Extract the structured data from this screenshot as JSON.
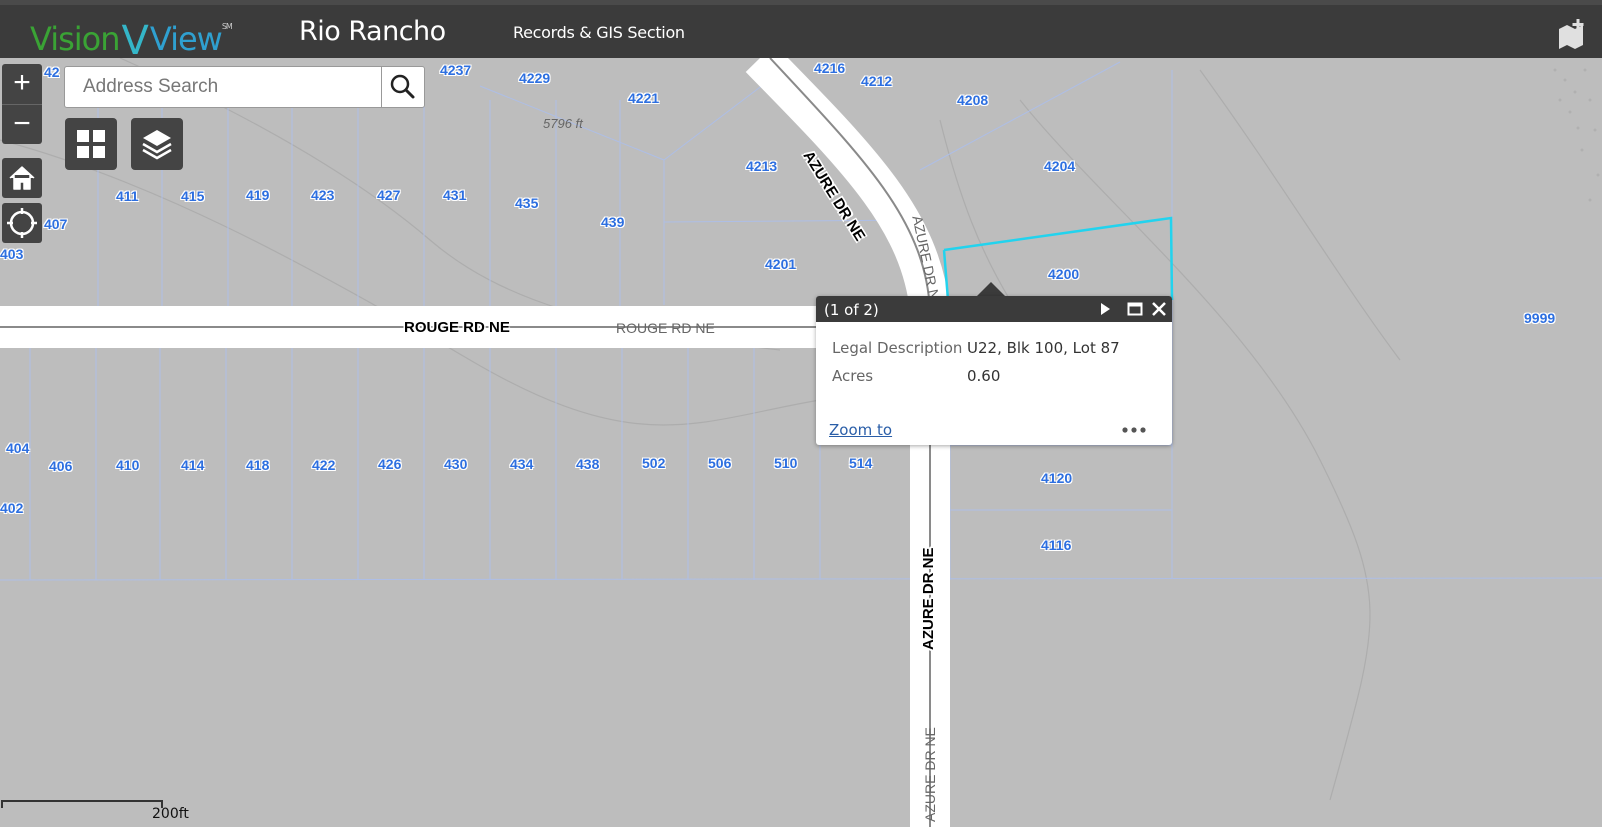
{
  "header": {
    "logo": {
      "part1": "Vision",
      "part2": "View",
      "mark": "SM"
    },
    "city": "Rio Rancho",
    "section": "Records & GIS Section",
    "save_icon": "save-map-icon"
  },
  "controls": {
    "zoom_in": "+",
    "zoom_out": "−",
    "search_placeholder": "Address Search",
    "icons": [
      "home-icon",
      "locate-icon",
      "search-icon",
      "basemap-grid-icon",
      "layers-icon"
    ]
  },
  "map": {
    "highlight_color": "#22d3ee",
    "parcel_label_color": "#2d6fe0",
    "elevation_label": "5796 ft",
    "parcel_labels": [
      "42",
      "4237",
      "4229",
      "4216",
      "4212",
      "4208",
      "4221",
      "4213",
      "4204",
      "4200",
      "4201",
      "411",
      "415",
      "419",
      "423",
      "427",
      "431",
      "435",
      "439",
      "407",
      "403",
      "9999",
      "404",
      "406",
      "410",
      "414",
      "418",
      "422",
      "426",
      "430",
      "434",
      "438",
      "502",
      "506",
      "510",
      "514",
      "4120",
      "4116",
      "402"
    ],
    "streets": [
      {
        "name": "ROUGE RD NE",
        "style": "halo"
      },
      {
        "name": "ROUGE RD NE",
        "style": "plain"
      },
      {
        "name": "AZURE DR NE",
        "style": "halo"
      },
      {
        "name": "AZURE DR NE",
        "style": "plain"
      },
      {
        "name": "AZURE DR NE",
        "style": "halo"
      },
      {
        "name": "AZURE DR NE",
        "style": "plain"
      }
    ],
    "scale": "200ft"
  },
  "popup": {
    "title": "(1 of 2)",
    "fields": [
      {
        "label": "Legal Description",
        "value": "U22, Blk 100, Lot 87"
      },
      {
        "label": "Acres",
        "value": "0.60"
      }
    ],
    "zoom_link": "Zoom to",
    "icons": [
      "next-icon",
      "maximize-icon",
      "close-icon",
      "more-options-icon"
    ]
  }
}
